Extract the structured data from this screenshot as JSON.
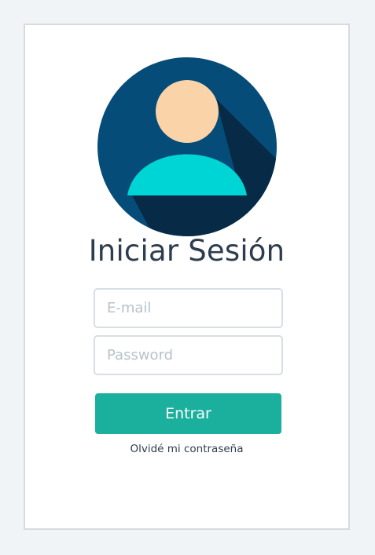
{
  "login": {
    "title": "Iniciar Sesión",
    "email_placeholder": "E-mail",
    "email_value": "",
    "password_placeholder": "Password",
    "password_value": "",
    "submit_label": "Entrar",
    "forgot_label": "Olvidé mi contraseña"
  },
  "icons": {
    "avatar": "user-avatar-icon"
  },
  "colors": {
    "page_background": "#f1f4f7",
    "card_background": "#ffffff",
    "card_border": "#d5dbe1",
    "avatar_circle": "#064c78",
    "avatar_shadow": "#072a46",
    "avatar_head": "#fbd3a8",
    "avatar_body": "#00d5d5",
    "title_text": "#2e3d4d",
    "input_border": "#d7dee5",
    "placeholder_text": "#b7c2cc",
    "button_background": "#1ab09d",
    "button_text": "#ffffff"
  }
}
